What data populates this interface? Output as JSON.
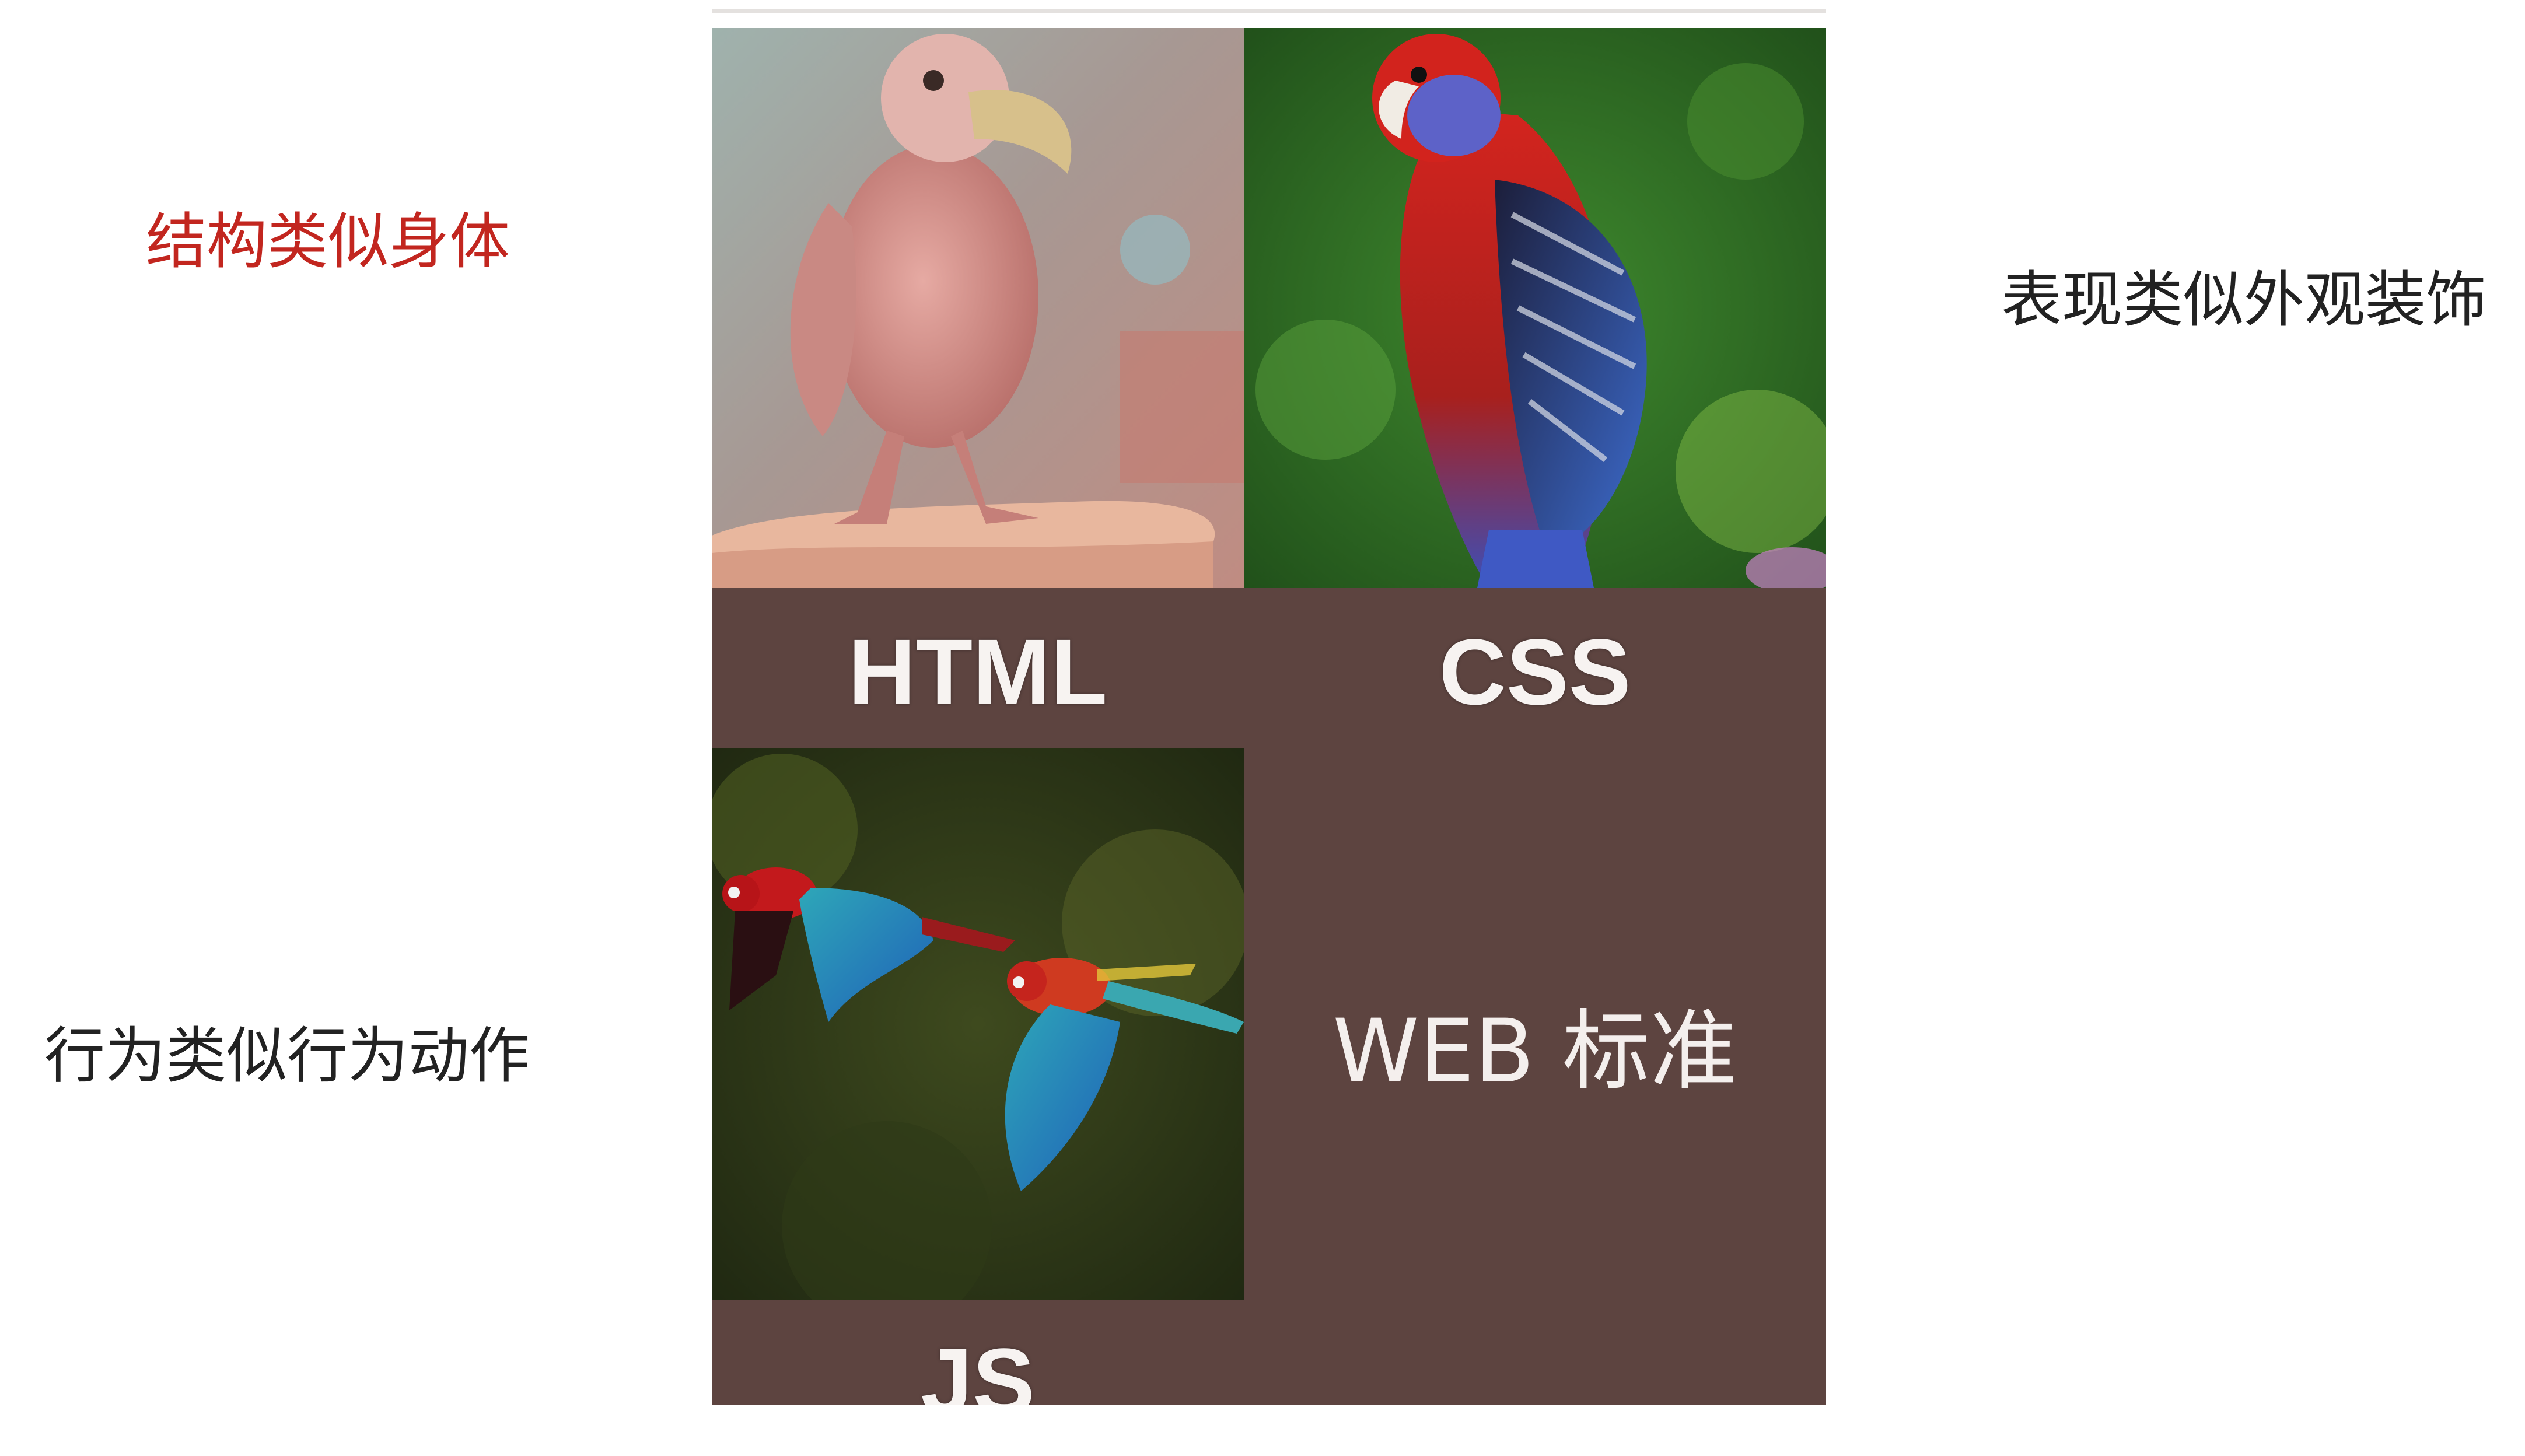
{
  "side_notes": {
    "structure": "结构类似身体",
    "presentation": "表现类似外观装饰",
    "behavior": "行为类似行为动作"
  },
  "figure": {
    "html_caption": "HTML",
    "css_caption": "CSS",
    "js_caption": "JS",
    "standard_caption": "WEB 标准"
  },
  "colors": {
    "structure_note": "#c2261f",
    "note_text": "#222222",
    "figure_background": "#5d4440",
    "caption_text": "#f7f3f1"
  },
  "images": [
    "featherless-parrot-photo",
    "rosella-parrot-photo",
    "flying-macaws-photo"
  ]
}
